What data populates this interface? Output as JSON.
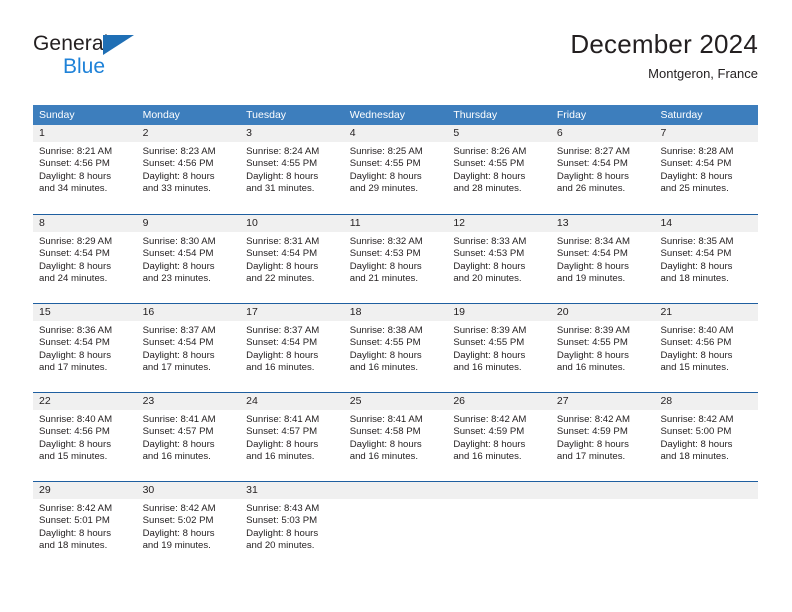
{
  "brand": {
    "name_part1": "General",
    "name_part2": "Blue",
    "logo_icon": "blue-triangle-icon",
    "accent_color": "#1f82d8"
  },
  "header": {
    "title": "December 2024",
    "location": "Montgeron, France"
  },
  "theme": {
    "header_blue": "#3d7ebd",
    "row_divider_blue": "#1f5fa0",
    "daynum_band": "#f0f0f0",
    "text": "#231f20"
  },
  "calendar": {
    "weekday_headers": [
      "Sunday",
      "Monday",
      "Tuesday",
      "Wednesday",
      "Thursday",
      "Friday",
      "Saturday"
    ],
    "weeks": [
      [
        {
          "day": "1",
          "lines": [
            "Sunrise: 8:21 AM",
            "Sunset: 4:56 PM",
            "Daylight: 8 hours",
            "and 34 minutes."
          ]
        },
        {
          "day": "2",
          "lines": [
            "Sunrise: 8:23 AM",
            "Sunset: 4:56 PM",
            "Daylight: 8 hours",
            "and 33 minutes."
          ]
        },
        {
          "day": "3",
          "lines": [
            "Sunrise: 8:24 AM",
            "Sunset: 4:55 PM",
            "Daylight: 8 hours",
            "and 31 minutes."
          ]
        },
        {
          "day": "4",
          "lines": [
            "Sunrise: 8:25 AM",
            "Sunset: 4:55 PM",
            "Daylight: 8 hours",
            "and 29 minutes."
          ]
        },
        {
          "day": "5",
          "lines": [
            "Sunrise: 8:26 AM",
            "Sunset: 4:55 PM",
            "Daylight: 8 hours",
            "and 28 minutes."
          ]
        },
        {
          "day": "6",
          "lines": [
            "Sunrise: 8:27 AM",
            "Sunset: 4:54 PM",
            "Daylight: 8 hours",
            "and 26 minutes."
          ]
        },
        {
          "day": "7",
          "lines": [
            "Sunrise: 8:28 AM",
            "Sunset: 4:54 PM",
            "Daylight: 8 hours",
            "and 25 minutes."
          ]
        }
      ],
      [
        {
          "day": "8",
          "lines": [
            "Sunrise: 8:29 AM",
            "Sunset: 4:54 PM",
            "Daylight: 8 hours",
            "and 24 minutes."
          ]
        },
        {
          "day": "9",
          "lines": [
            "Sunrise: 8:30 AM",
            "Sunset: 4:54 PM",
            "Daylight: 8 hours",
            "and 23 minutes."
          ]
        },
        {
          "day": "10",
          "lines": [
            "Sunrise: 8:31 AM",
            "Sunset: 4:54 PM",
            "Daylight: 8 hours",
            "and 22 minutes."
          ]
        },
        {
          "day": "11",
          "lines": [
            "Sunrise: 8:32 AM",
            "Sunset: 4:53 PM",
            "Daylight: 8 hours",
            "and 21 minutes."
          ]
        },
        {
          "day": "12",
          "lines": [
            "Sunrise: 8:33 AM",
            "Sunset: 4:53 PM",
            "Daylight: 8 hours",
            "and 20 minutes."
          ]
        },
        {
          "day": "13",
          "lines": [
            "Sunrise: 8:34 AM",
            "Sunset: 4:54 PM",
            "Daylight: 8 hours",
            "and 19 minutes."
          ]
        },
        {
          "day": "14",
          "lines": [
            "Sunrise: 8:35 AM",
            "Sunset: 4:54 PM",
            "Daylight: 8 hours",
            "and 18 minutes."
          ]
        }
      ],
      [
        {
          "day": "15",
          "lines": [
            "Sunrise: 8:36 AM",
            "Sunset: 4:54 PM",
            "Daylight: 8 hours",
            "and 17 minutes."
          ]
        },
        {
          "day": "16",
          "lines": [
            "Sunrise: 8:37 AM",
            "Sunset: 4:54 PM",
            "Daylight: 8 hours",
            "and 17 minutes."
          ]
        },
        {
          "day": "17",
          "lines": [
            "Sunrise: 8:37 AM",
            "Sunset: 4:54 PM",
            "Daylight: 8 hours",
            "and 16 minutes."
          ]
        },
        {
          "day": "18",
          "lines": [
            "Sunrise: 8:38 AM",
            "Sunset: 4:55 PM",
            "Daylight: 8 hours",
            "and 16 minutes."
          ]
        },
        {
          "day": "19",
          "lines": [
            "Sunrise: 8:39 AM",
            "Sunset: 4:55 PM",
            "Daylight: 8 hours",
            "and 16 minutes."
          ]
        },
        {
          "day": "20",
          "lines": [
            "Sunrise: 8:39 AM",
            "Sunset: 4:55 PM",
            "Daylight: 8 hours",
            "and 16 minutes."
          ]
        },
        {
          "day": "21",
          "lines": [
            "Sunrise: 8:40 AM",
            "Sunset: 4:56 PM",
            "Daylight: 8 hours",
            "and 15 minutes."
          ]
        }
      ],
      [
        {
          "day": "22",
          "lines": [
            "Sunrise: 8:40 AM",
            "Sunset: 4:56 PM",
            "Daylight: 8 hours",
            "and 15 minutes."
          ]
        },
        {
          "day": "23",
          "lines": [
            "Sunrise: 8:41 AM",
            "Sunset: 4:57 PM",
            "Daylight: 8 hours",
            "and 16 minutes."
          ]
        },
        {
          "day": "24",
          "lines": [
            "Sunrise: 8:41 AM",
            "Sunset: 4:57 PM",
            "Daylight: 8 hours",
            "and 16 minutes."
          ]
        },
        {
          "day": "25",
          "lines": [
            "Sunrise: 8:41 AM",
            "Sunset: 4:58 PM",
            "Daylight: 8 hours",
            "and 16 minutes."
          ]
        },
        {
          "day": "26",
          "lines": [
            "Sunrise: 8:42 AM",
            "Sunset: 4:59 PM",
            "Daylight: 8 hours",
            "and 16 minutes."
          ]
        },
        {
          "day": "27",
          "lines": [
            "Sunrise: 8:42 AM",
            "Sunset: 4:59 PM",
            "Daylight: 8 hours",
            "and 17 minutes."
          ]
        },
        {
          "day": "28",
          "lines": [
            "Sunrise: 8:42 AM",
            "Sunset: 5:00 PM",
            "Daylight: 8 hours",
            "and 18 minutes."
          ]
        }
      ],
      [
        {
          "day": "29",
          "lines": [
            "Sunrise: 8:42 AM",
            "Sunset: 5:01 PM",
            "Daylight: 8 hours",
            "and 18 minutes."
          ]
        },
        {
          "day": "30",
          "lines": [
            "Sunrise: 8:42 AM",
            "Sunset: 5:02 PM",
            "Daylight: 8 hours",
            "and 19 minutes."
          ]
        },
        {
          "day": "31",
          "lines": [
            "Sunrise: 8:43 AM",
            "Sunset: 5:03 PM",
            "Daylight: 8 hours",
            "and 20 minutes."
          ]
        },
        {
          "day": "",
          "lines": []
        },
        {
          "day": "",
          "lines": []
        },
        {
          "day": "",
          "lines": []
        },
        {
          "day": "",
          "lines": []
        }
      ]
    ]
  }
}
